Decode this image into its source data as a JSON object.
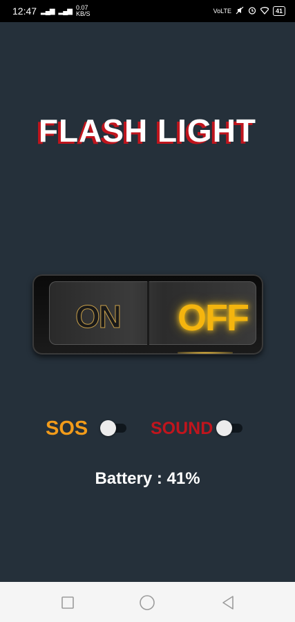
{
  "status_bar": {
    "time": "12:47",
    "network_label": "VoLTE",
    "data_rate": "0.07",
    "data_rate_unit": "KB/S",
    "battery": "41",
    "icons": [
      "signal-icon",
      "wifi-icon",
      "volte-icon",
      "mute-icon",
      "alarm-icon",
      "battery-icon"
    ]
  },
  "app": {
    "title": "FLASH LIGHT",
    "switch": {
      "on_label": "ON",
      "off_label": "OFF",
      "state": "off"
    },
    "sos": {
      "label": "SOS",
      "enabled": false
    },
    "sound": {
      "label": "SOUND",
      "enabled": false
    },
    "battery_text": "Battery : 41%"
  },
  "colors": {
    "background": "#25303a",
    "sos": "#f29b1a",
    "sound": "#c0151d",
    "off_glow": "#f5b50e",
    "title_shadow": "#c0151d"
  },
  "nav_bar": {
    "buttons": [
      "recent-apps-icon",
      "home-icon",
      "back-icon"
    ]
  }
}
